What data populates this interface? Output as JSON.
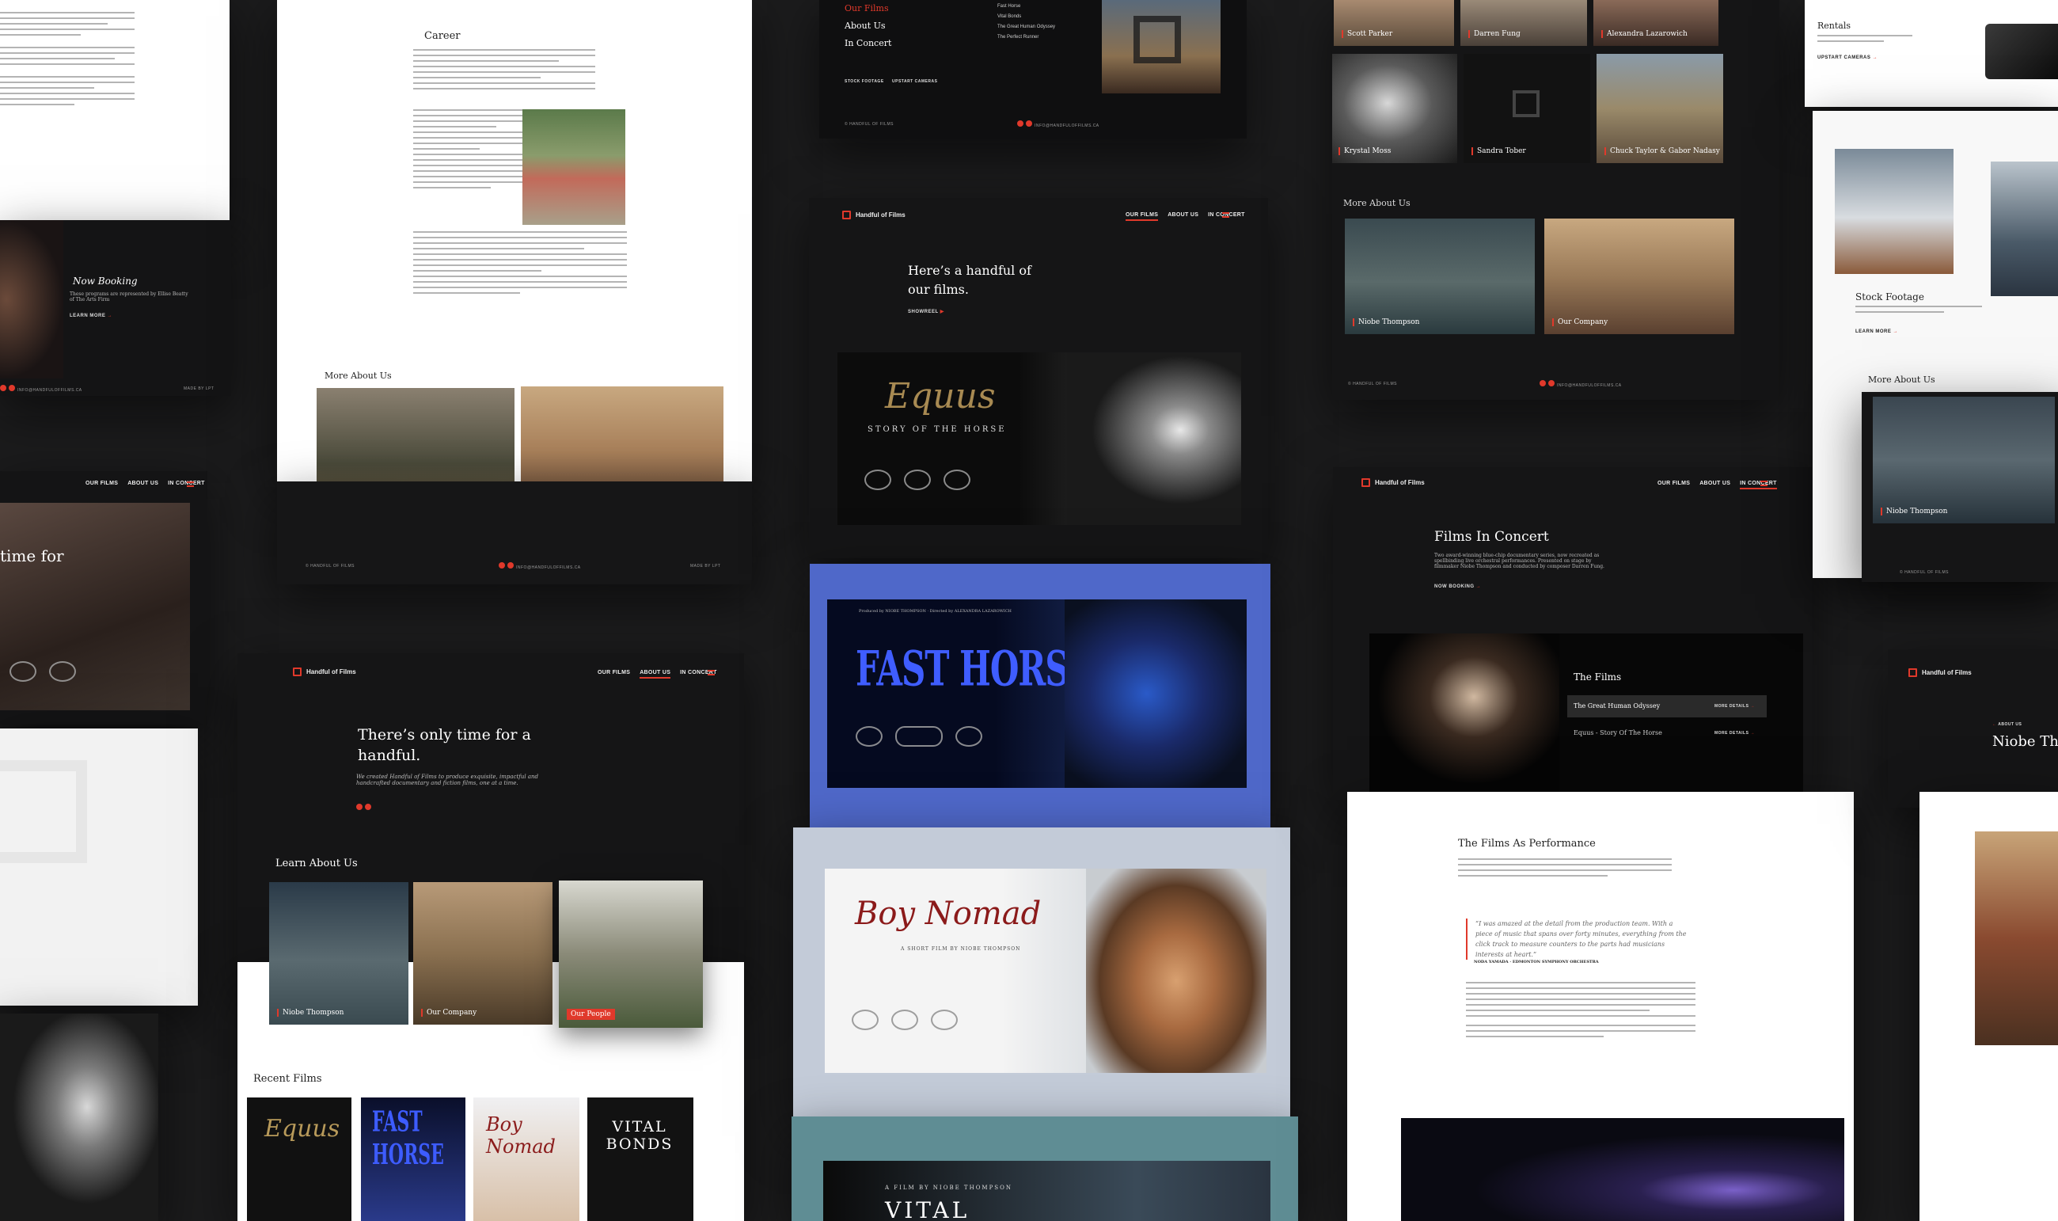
{
  "brand": {
    "name": "Handful of Films",
    "accent": "#e0392b"
  },
  "nav": {
    "films": "OUR FILMS",
    "about": "ABOUT US",
    "concert": "IN CONCERT"
  },
  "menu_overlay": {
    "items": [
      "Our Films",
      "About Us",
      "In Concert"
    ],
    "films": [
      "Fast Horse",
      "Vital Bonds",
      "The Great Human Odyssey",
      "The Perfect Runner"
    ],
    "links": [
      "STOCK FOOTAGE",
      "UPSTART CAMERAS"
    ]
  },
  "career": {
    "heading": "Career"
  },
  "more_about": {
    "heading": "More About Us",
    "people": "Our People",
    "company": "Our Company",
    "niobe": "Niobe Thompson"
  },
  "booking": {
    "title": "Now Booking",
    "text": "These programs are represented by Ellise Beatty of The Arts Firm",
    "link": "LEARN MORE"
  },
  "team": {
    "names": [
      "Scott Parker",
      "Darren Fung",
      "Alexandra Lazarowich",
      "Krystal Moss",
      "Sandra Tober",
      "Chuck Taylor & Gabor Nadasy"
    ]
  },
  "home": {
    "headline": "Here’s a handful of our films.",
    "showreel": "SHOWREEL"
  },
  "films": {
    "equus": {
      "title": "Equus",
      "subtitle": "STORY OF THE HORSE"
    },
    "fast_horse": {
      "title": "FAST HORSE",
      "credit": "Produced by NIOBE THOMPSON · Directed by ALEXANDRA LAZAROWICH"
    },
    "boy_nomad": {
      "title": "Boy Nomad",
      "credit": "A SHORT FILM BY NIOBE THOMPSON"
    },
    "vital": {
      "title": "VITAL",
      "credit": "A FILM BY NIOBE THOMPSON"
    }
  },
  "about": {
    "headline": "There’s only time for a handful.",
    "body": "We created Handful of Films to produce exquisite, impactful and handcrafted documentary and fiction films, one at a time.",
    "learn": "Learn About Us",
    "recent": "Recent Films",
    "poster_titles": [
      "Equus",
      "FAST HORSE",
      "Boy Nomad",
      "VITAL BONDS"
    ]
  },
  "concert": {
    "title": "Films In Concert",
    "text": "Two award-winning blue-chip documentary series, now recreated as spellbinding live orchestral performances. Presented on stage by filmmaker Niobe Thompson and conducted by composer Darren Fung.",
    "link": "NOW BOOKING",
    "films_heading": "The Films",
    "film1": "The Great Human Odyssey",
    "film2": "Equus - Story Of The Horse",
    "more": "MORE DETAILS",
    "performance": "The Films As Performance",
    "quote": "“I was amazed at the detail from the production team. With a piece of music that spans over forty minutes, everything from the click track to measure counters to the parts had musicians interests at heart.”",
    "quote_by": "NODA YAMADA · EDMONTON SYMPHONY ORCHESTRA"
  },
  "right": {
    "rentals": "Rentals",
    "upstart": "UPSTART CAMERAS",
    "stock": "Stock Footage",
    "learn": "LEARN MORE",
    "about_label": "ABOUT US",
    "niobe": "Niobe Th"
  },
  "misc": {
    "time_for": "time for",
    "made_by": "MADE BY LPT",
    "copyright": "© HANDFUL OF FILMS",
    "email": "INFO@HANDFULOFFILMS.CA"
  }
}
